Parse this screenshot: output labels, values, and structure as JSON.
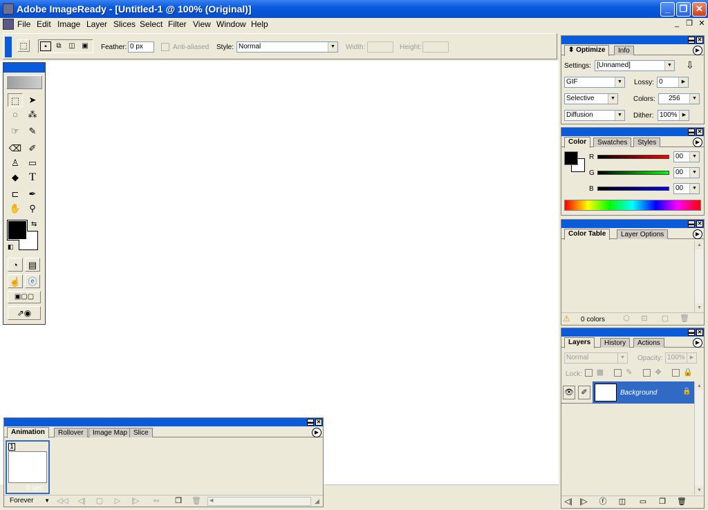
{
  "app": {
    "title": "Adobe ImageReady - [Untitled-1 @ 100% (Original)]"
  },
  "menu": [
    "File",
    "Edit",
    "Image",
    "Layer",
    "Slices",
    "Select",
    "Filter",
    "View",
    "Window",
    "Help"
  ],
  "options_bar": {
    "feather_label": "Feather:",
    "feather_value": "0 px",
    "antialiased_label": "Anti-aliased",
    "style_label": "Style:",
    "style_value": "Normal",
    "width_label": "Width:",
    "height_label": "Height:"
  },
  "optimize_panel": {
    "tabs": [
      "Optimize",
      "Info"
    ],
    "settings_label": "Settings:",
    "settings_value": "[Unnamed]",
    "format_value": "GIF",
    "lossy_label": "Lossy:",
    "lossy_value": "0",
    "palette_value": "Selective",
    "colors_label": "Colors:",
    "colors_value": "256",
    "dither_method": "Diffusion",
    "dither_label": "Dither:",
    "dither_value": "100%"
  },
  "color_panel": {
    "tabs": [
      "Color",
      "Swatches",
      "Styles"
    ],
    "r_label": "R",
    "g_label": "G",
    "b_label": "B",
    "r_value": "00",
    "g_value": "00",
    "b_value": "00"
  },
  "color_table_panel": {
    "tabs": [
      "Color Table",
      "Layer Options"
    ],
    "status": "0 colors"
  },
  "layers_panel": {
    "tabs": [
      "Layers",
      "History",
      "Actions"
    ],
    "blend_mode": "Normal",
    "opacity_label": "Opacity:",
    "opacity_value": "100%",
    "lock_label": "Lock:",
    "layer_name": "Background"
  },
  "animation_panel": {
    "tabs": [
      "Animation",
      "Rollover",
      "Image Map",
      "Slice"
    ],
    "frame_number": "1",
    "frame_delay": "0 sec.",
    "loop_value": "Forever"
  },
  "colors": {
    "title_blue": "#0a5bdc",
    "panel_bg": "#ece9d8",
    "layer_selected": "#316ac5"
  }
}
